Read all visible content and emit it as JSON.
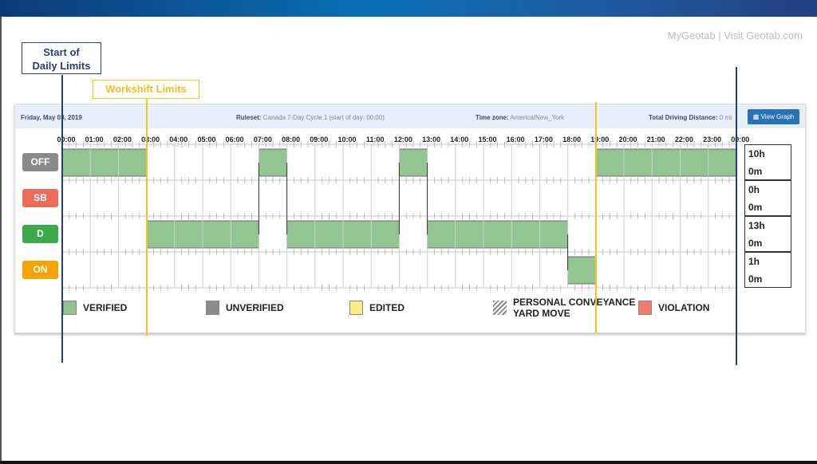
{
  "brand_link": "MyGeotab | Visit Geotab.com",
  "callouts": {
    "daily": "Start of Daily Limits",
    "daily_l1": "Start of",
    "daily_l2": "Daily Limits",
    "workshift": "Workshift Limits"
  },
  "header": {
    "date": "Friday, May 03, 2019",
    "ruleset_label": "Ruleset:",
    "ruleset": "Canada 7-Day Cycle 1 (start of day: 00:00)",
    "timezone_label": "Time zone:",
    "timezone": "America/New_York",
    "distance_label": "Total Driving Distance:",
    "distance": "0 mi",
    "view_graph": "View Graph"
  },
  "hours": [
    "00:00",
    "01:00",
    "02:00",
    "03:00",
    "04:00",
    "05:00",
    "06:00",
    "07:00",
    "08:00",
    "09:00",
    "10:00",
    "11:00",
    "12:00",
    "13:00",
    "14:00",
    "15:00",
    "16:00",
    "17:00",
    "18:00",
    "19:00",
    "20:00",
    "21:00",
    "22:00",
    "23:00",
    "00:00"
  ],
  "statuses": [
    {
      "code": "OFF",
      "color": "#8a8a8a",
      "total_h": "10h",
      "total_m": "0m"
    },
    {
      "code": "SB",
      "color": "#ee6a5a",
      "total_h": "0h",
      "total_m": "0m"
    },
    {
      "code": "D",
      "color": "#3aaa4c",
      "total_h": "13h",
      "total_m": "0m"
    },
    {
      "code": "ON",
      "color": "#f5a300",
      "total_h": "1h",
      "total_m": "0m"
    }
  ],
  "segments": [
    {
      "status": "OFF",
      "start": 0,
      "end": 3
    },
    {
      "status": "D",
      "start": 3,
      "end": 7
    },
    {
      "status": "OFF",
      "start": 7,
      "end": 8
    },
    {
      "status": "D",
      "start": 8,
      "end": 12
    },
    {
      "status": "OFF",
      "start": 12,
      "end": 13
    },
    {
      "status": "D",
      "start": 13,
      "end": 18
    },
    {
      "status": "ON",
      "start": 18,
      "end": 19
    },
    {
      "status": "OFF",
      "start": 19,
      "end": 24
    }
  ],
  "markers": {
    "daily_start_hour": 0,
    "daily_end_hour": 24,
    "workshift_start_hour": 3,
    "workshift_end_hour": 19,
    "daily_color": "#233f78",
    "workshift_color": "#f4c51c"
  },
  "legend": [
    {
      "label": "VERIFIED",
      "color": "#8fc48f"
    },
    {
      "label": "UNVERIFIED",
      "color": "#8c8c8c"
    },
    {
      "label": "EDITED",
      "color": "#fbee8a"
    },
    {
      "label": "PERSONAL CONVEYANCE",
      "label2": "YARD MOVE",
      "color": "hatched"
    },
    {
      "label": "VIOLATION",
      "color": "#f47c6c"
    }
  ],
  "verified_color": "#93c593"
}
